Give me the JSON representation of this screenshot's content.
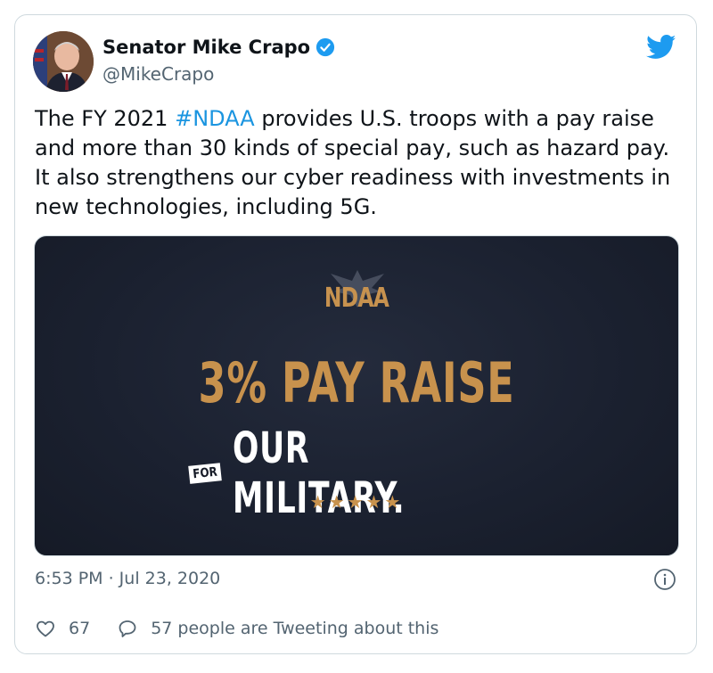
{
  "tweet": {
    "author_name": "Senator Mike Crapo",
    "handle": "@MikeCrapo",
    "text_before": "The FY 2021 ",
    "hashtag": "#NDAA",
    "text_after": " provides U.S. troops with a pay raise and more than 30 kinds of special pay, such as hazard pay. It also strengthens our cyber readiness with investments in new technologies, including 5G.",
    "timestamp": "6:53 PM · Jul 23, 2020",
    "likes": "67",
    "retweet_text": "57 people are Tweeting about this"
  },
  "media": {
    "logo": "NDAA",
    "headline": "3% PAY RAISE",
    "for_tag": "FOR",
    "subline": "OUR MILITARY.",
    "stars": "★★★★★"
  },
  "icons": {
    "verified": "verified-badge-icon",
    "bird": "twitter-bird-icon",
    "info": "info-icon",
    "heart": "heart-icon",
    "comment": "comment-icon"
  },
  "colors": {
    "accent": "#1b95e0",
    "gold": "#c8924d",
    "media_bg": "#1b2130",
    "muted": "#536471"
  }
}
